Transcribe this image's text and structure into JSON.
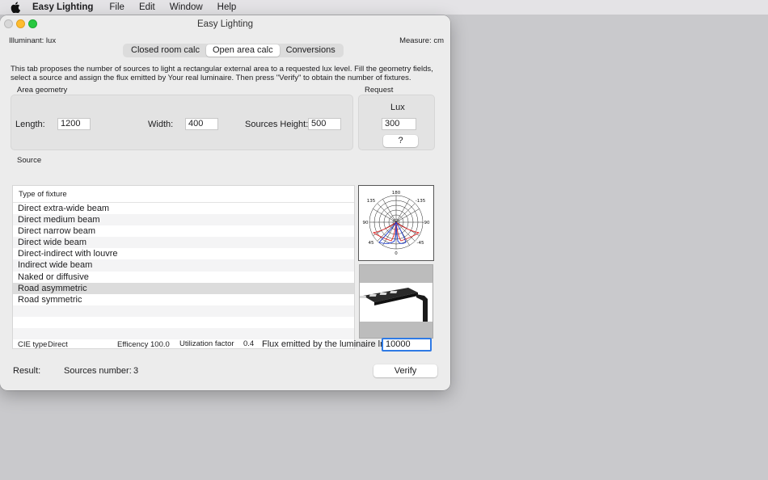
{
  "menubar": {
    "app_name": "Easy Lighting",
    "items": [
      "File",
      "Edit",
      "Window",
      "Help"
    ]
  },
  "window": {
    "title": "Easy Lighting",
    "illuminant": "Illuminant: lux",
    "measure": "Measure: cm",
    "tabs": [
      {
        "label": "Closed room calc",
        "active": false
      },
      {
        "label": "Open area calc",
        "active": true
      },
      {
        "label": "Conversions",
        "active": false
      }
    ],
    "description": "This tab proposes the number of sources to light a rectangular external area to a requested lux level. Fill the geometry fields, select a source and assign the flux emitted by Your real luminaire. Then press \"Verify\" to obtain the number of fixtures."
  },
  "geometry": {
    "section_label": "Area geometry",
    "length_label": "Length:",
    "length_value": "1200",
    "width_label": "Width:",
    "width_value": "400",
    "height_label": "Sources Height:",
    "height_value": "500"
  },
  "request": {
    "section_label": "Request",
    "lux_label": "Lux",
    "lux_value": "300",
    "help_button": "?"
  },
  "source": {
    "section_label": "Source",
    "column_header": "Type of fixture",
    "fixtures": [
      "Direct extra-wide beam",
      "Direct medium beam",
      "Direct narrow beam",
      "Direct wide beam",
      "Direct-indirect with louvre",
      "Indirect wide beam",
      "Naked or diffusive",
      "Road asymmetric",
      "Road symmetric"
    ],
    "selected_index": 7,
    "polar_labels": {
      "top": "180",
      "tl": "135",
      "tr": "-135",
      "left": "90",
      "right": "-90",
      "bl": "45",
      "br": "-45",
      "bottom": "0"
    }
  },
  "info": {
    "cie_label": "CIE type",
    "cie_value": "Direct",
    "efficiency_label": "Efficency",
    "efficiency_value": "100.0",
    "util_label": "Utilization factor",
    "util_value": "0.4",
    "flux_label": "Flux emitted by the luminaire lm:",
    "flux_value": "10000"
  },
  "result": {
    "label": "Result:",
    "sources_label": "Sources number:",
    "sources_value": "3",
    "verify_button": "Verify"
  },
  "colors": {
    "accent": "#2f7ae5",
    "desktop": "#c9c9cc",
    "window": "#ececec"
  }
}
